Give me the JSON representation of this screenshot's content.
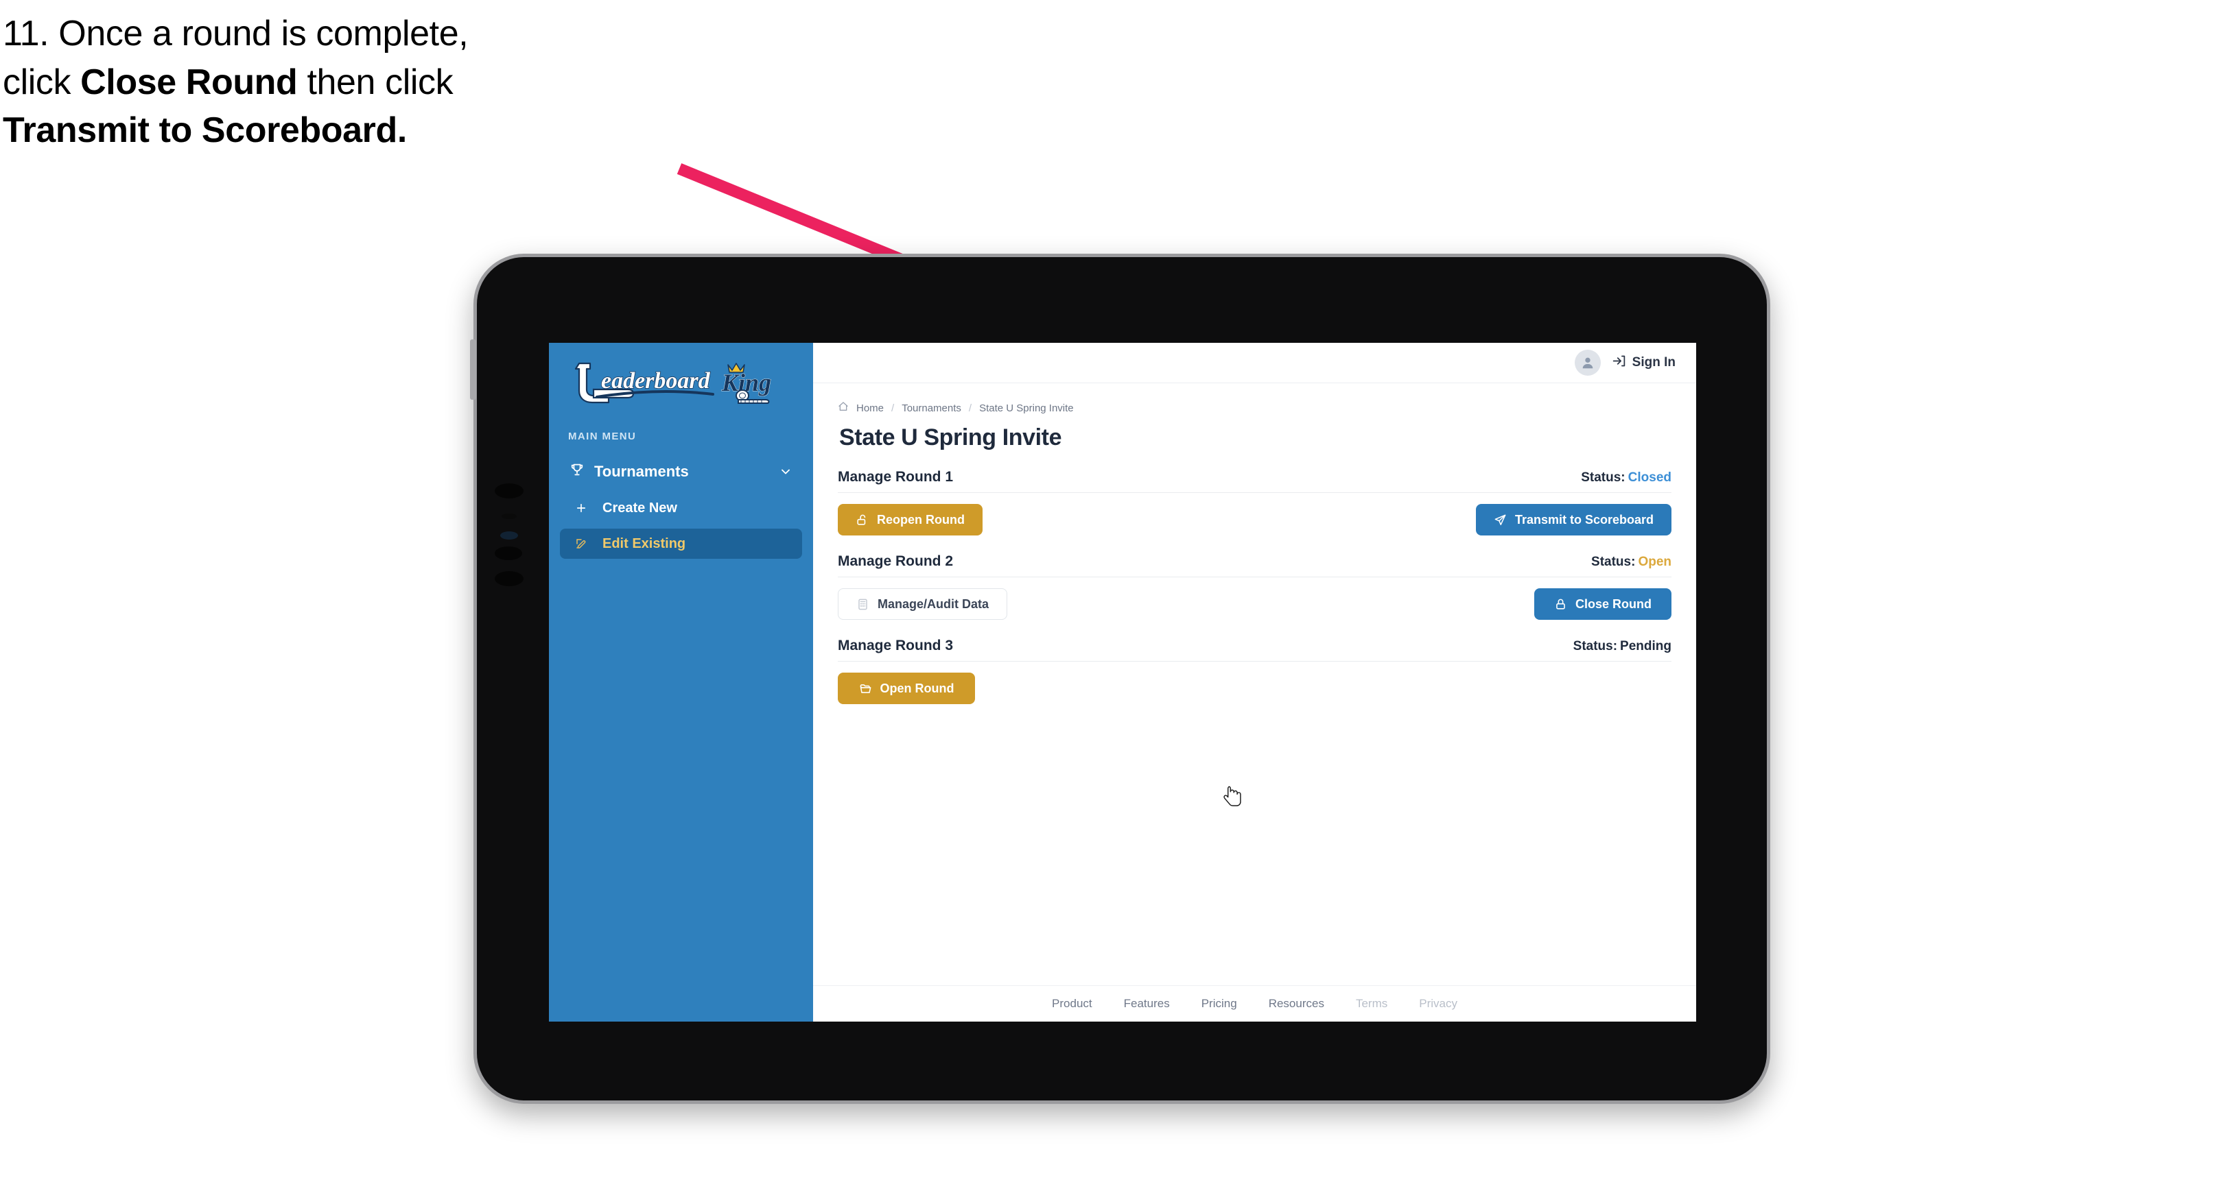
{
  "caption": {
    "line1_plain": "11. Once a round is complete,",
    "line2_pre": "click ",
    "line2_bold": "Close Round",
    "line2_post": " then click",
    "line3_bold": "Transmit to Scoreboard."
  },
  "annotation": {
    "arrow_color": "#ec225f",
    "points_to": "Transmit to Scoreboard"
  },
  "sidebar": {
    "logo_primary": "Leaderboard",
    "logo_secondary": "King",
    "section_label": "MAIN MENU",
    "nav": {
      "label": "Tournaments",
      "icon": "trophy-icon",
      "chevron": "chevron-down-icon"
    },
    "items": [
      {
        "label": "Create New",
        "icon": "plus-icon",
        "active": false
      },
      {
        "label": "Edit Existing",
        "icon": "edit-pencil-icon",
        "active": true
      }
    ],
    "bg_color": "#2f80bd",
    "active_bg": "#1d6399",
    "active_text": "#f0c96a"
  },
  "topbar": {
    "avatar_icon": "user-avatar-icon",
    "signin_icon": "sign-in-arrow-icon",
    "signin_label": "Sign In"
  },
  "breadcrumb": {
    "home_icon": "home-icon",
    "items": [
      "Home",
      "Tournaments",
      "State U Spring Invite"
    ],
    "separator": "/"
  },
  "page": {
    "title": "State U Spring Invite"
  },
  "rounds": [
    {
      "name": "Manage Round 1",
      "status_label": "Status:",
      "status_value": "Closed",
      "status_class": "closed",
      "left_button": {
        "label": "Reopen Round",
        "icon": "unlock-icon",
        "style": "gold"
      },
      "right_button": {
        "label": "Transmit to Scoreboard",
        "icon": "send-paper-plane-icon",
        "style": "blue"
      }
    },
    {
      "name": "Manage Round 2",
      "status_label": "Status:",
      "status_value": "Open",
      "status_class": "open",
      "left_button": {
        "label": "Manage/Audit Data",
        "icon": "calculator-icon",
        "style": "ghost"
      },
      "right_button": {
        "label": "Close Round",
        "icon": "lock-icon",
        "style": "blue"
      }
    },
    {
      "name": "Manage Round 3",
      "status_label": "Status:",
      "status_value": "Pending",
      "status_class": "pending",
      "left_button": {
        "label": "Open Round",
        "icon": "folder-open-icon",
        "style": "gold"
      },
      "right_button": null
    }
  ],
  "footer": {
    "links": [
      {
        "label": "Product",
        "muted": false
      },
      {
        "label": "Features",
        "muted": false
      },
      {
        "label": "Pricing",
        "muted": false
      },
      {
        "label": "Resources",
        "muted": false
      },
      {
        "label": "Terms",
        "muted": true
      },
      {
        "label": "Privacy",
        "muted": true
      }
    ]
  },
  "colors": {
    "gold": "#cf9b29",
    "blue": "#2b7ab9",
    "sidebar_blue": "#2f80bd",
    "status_closed": "#3d8fd6",
    "status_open": "#dba83c",
    "ink": "#1f2a3c"
  },
  "cursor": {
    "type": "pointing-hand-cursor"
  }
}
